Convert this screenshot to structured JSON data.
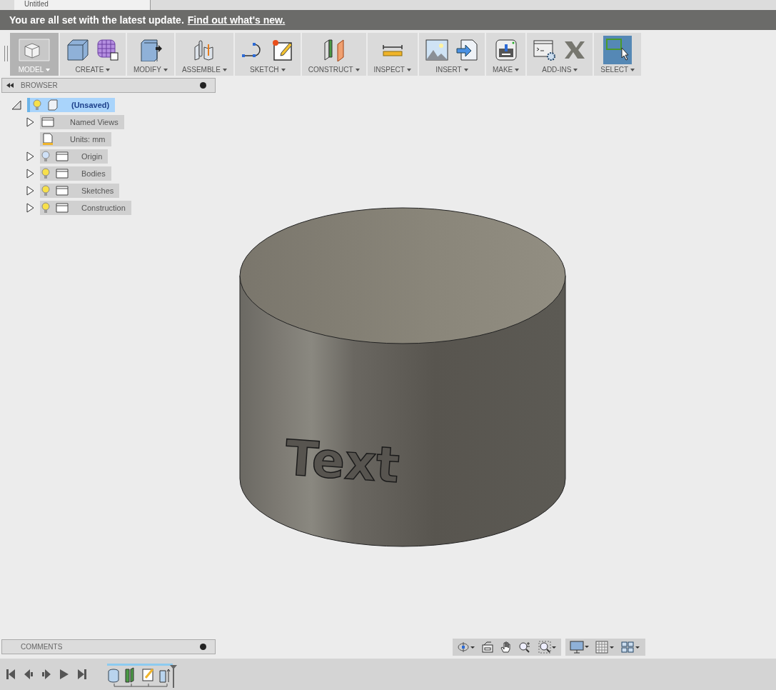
{
  "tab": {
    "title": "Untitled"
  },
  "banner": {
    "message": "You are all set with the latest update.",
    "link": "Find out what's new."
  },
  "toolbar": [
    {
      "label": "MODEL",
      "kind": "model",
      "selected": true
    },
    {
      "label": "CREATE",
      "kind": "create",
      "selected": false
    },
    {
      "label": "MODIFY",
      "kind": "modify",
      "selected": false
    },
    {
      "label": "ASSEMBLE",
      "kind": "assemble",
      "selected": false
    },
    {
      "label": "SKETCH",
      "kind": "sketch",
      "selected": false
    },
    {
      "label": "CONSTRUCT",
      "kind": "construct",
      "selected": false
    },
    {
      "label": "INSPECT",
      "kind": "inspect",
      "selected": false
    },
    {
      "label": "INSERT",
      "kind": "insert",
      "selected": false
    },
    {
      "label": "MAKE",
      "kind": "make",
      "selected": false
    },
    {
      "label": "ADD-INS",
      "kind": "addins",
      "selected": false
    },
    {
      "label": "SELECT",
      "kind": "select",
      "selected": true
    }
  ],
  "browser": {
    "title": "BROWSER",
    "tree": {
      "label": "(Unsaved)",
      "expanded": true,
      "selected": true,
      "visible": true,
      "kind": "component",
      "children": [
        {
          "label": "Named Views",
          "kind": "folder",
          "expanded": false
        },
        {
          "label": "Units: mm",
          "kind": "units"
        },
        {
          "label": "Origin",
          "kind": "folder",
          "expanded": false,
          "visible": false
        },
        {
          "label": "Bodies",
          "kind": "folder",
          "expanded": false,
          "visible": true
        },
        {
          "label": "Sketches",
          "kind": "folder",
          "expanded": false,
          "visible": true
        },
        {
          "label": "Construction",
          "kind": "folder",
          "expanded": false,
          "visible": true
        }
      ]
    }
  },
  "viewport": {
    "embossed_text": "Text"
  },
  "comments": {
    "title": "COMMENTS"
  }
}
